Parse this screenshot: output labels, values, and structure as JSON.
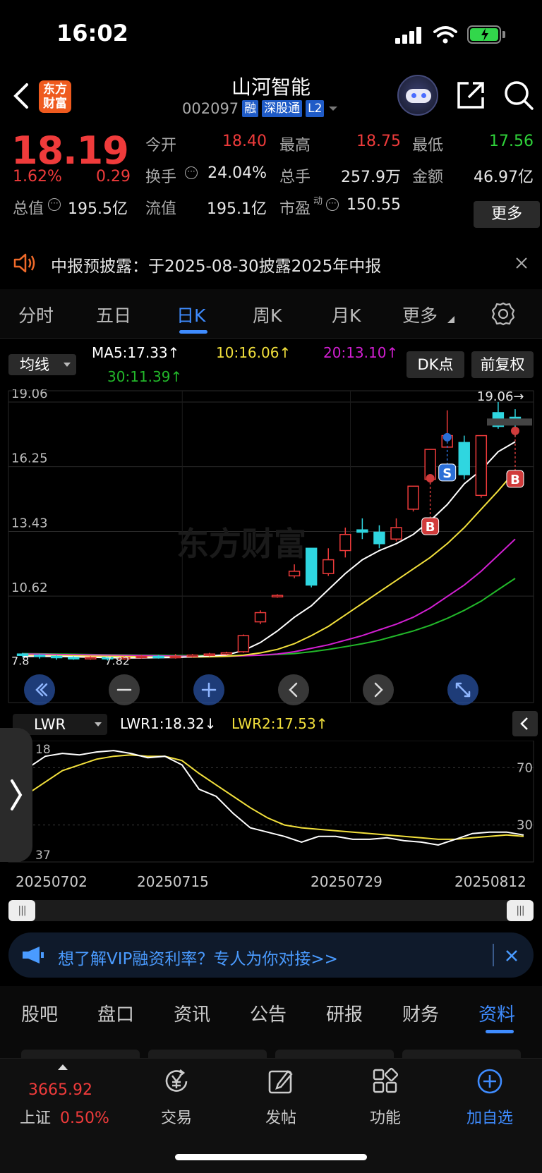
{
  "status_bar": {
    "time": "16:02"
  },
  "header": {
    "title": "山河智能",
    "code": "002097",
    "tags": [
      "融",
      "深股通",
      "L2"
    ],
    "logo_line1": "东方",
    "logo_line2": "财富"
  },
  "quote": {
    "price": "18.19",
    "change_pct": "1.62%",
    "change": "0.29",
    "total_value_label": "总值",
    "total_value": "195.5亿",
    "open_label": "今开",
    "open": "18.40",
    "high_label": "最高",
    "high": "18.75",
    "low_label": "最低",
    "low": "17.56",
    "turnover_label": "换手",
    "turnover": "24.04%",
    "volume_label": "总手",
    "volume": "257.9万",
    "amount_label": "金额",
    "amount": "46.97亿",
    "float_label": "流值",
    "float": "195.1亿",
    "pe_label": "市盈",
    "pe_sup": "动",
    "pe": "150.55",
    "more_label": "更多"
  },
  "notice": {
    "text": "中报预披露：于2025-08-30披露2025年中报"
  },
  "period_tabs": [
    {
      "label": "分时"
    },
    {
      "label": "五日"
    },
    {
      "label": "日K",
      "active": true
    },
    {
      "label": "周K"
    },
    {
      "label": "月K"
    },
    {
      "label": "更多"
    }
  ],
  "ma_row": {
    "selector": "均线",
    "ma5": "MA5:17.33↑",
    "ma10": "10:16.06↑",
    "ma20": "20:13.10↑",
    "ma30": "30:11.39↑",
    "dk_label": "DK点",
    "adjust_label": "前复权"
  },
  "colors": {
    "up": "#ef3b3b",
    "down": "#2fd6e0",
    "ma5": "#ffffff",
    "ma10": "#f2e03c",
    "ma20": "#d21fd2",
    "ma30": "#22b82a",
    "accent": "#3f8cff"
  },
  "chart_data": {
    "type": "candlestick",
    "y_ticks": [
      "19.06",
      "16.25",
      "13.43",
      "10.62"
    ],
    "ylim": [
      7.8,
      19.06
    ],
    "high_marker": "19.06→",
    "low_marker": "7.82",
    "left_low_label": "7.8",
    "watermark": "东方财富",
    "candles": [
      {
        "o": 8.1,
        "c": 8.05,
        "h": 8.15,
        "l": 7.95
      },
      {
        "o": 8.05,
        "c": 8.0,
        "h": 8.1,
        "l": 7.9
      },
      {
        "o": 8.0,
        "c": 7.95,
        "h": 8.05,
        "l": 7.85
      },
      {
        "o": 7.95,
        "c": 7.9,
        "h": 8.0,
        "l": 7.85
      },
      {
        "o": 7.9,
        "c": 7.95,
        "h": 8.0,
        "l": 7.85
      },
      {
        "o": 7.95,
        "c": 7.9,
        "h": 8.0,
        "l": 7.82
      },
      {
        "o": 7.9,
        "c": 7.95,
        "h": 8.0,
        "l": 7.85
      },
      {
        "o": 7.95,
        "c": 8.0,
        "h": 8.05,
        "l": 7.9
      },
      {
        "o": 8.0,
        "c": 7.95,
        "h": 8.05,
        "l": 7.9
      },
      {
        "o": 7.95,
        "c": 8.0,
        "h": 8.1,
        "l": 7.9
      },
      {
        "o": 8.0,
        "c": 8.05,
        "h": 8.1,
        "l": 7.95
      },
      {
        "o": 8.05,
        "c": 8.1,
        "h": 8.15,
        "l": 8.0
      },
      {
        "o": 8.1,
        "c": 8.15,
        "h": 8.2,
        "l": 8.05
      },
      {
        "o": 8.2,
        "c": 8.9,
        "h": 8.95,
        "l": 8.15
      },
      {
        "o": 9.5,
        "c": 9.9,
        "h": 10.0,
        "l": 9.4
      },
      {
        "o": 10.6,
        "c": 10.65,
        "h": 10.7,
        "l": 10.55
      },
      {
        "o": 11.5,
        "c": 11.7,
        "h": 12.0,
        "l": 11.4
      },
      {
        "o": 12.7,
        "c": 11.1,
        "h": 12.7,
        "l": 11.0
      },
      {
        "o": 11.6,
        "c": 12.2,
        "h": 12.7,
        "l": 11.5
      },
      {
        "o": 12.6,
        "c": 13.3,
        "h": 13.6,
        "l": 12.3
      },
      {
        "o": 13.5,
        "c": 13.4,
        "h": 14.0,
        "l": 13.1
      },
      {
        "o": 13.4,
        "c": 12.9,
        "h": 13.7,
        "l": 12.7
      },
      {
        "o": 13.1,
        "c": 13.6,
        "h": 14.0,
        "l": 13.0
      },
      {
        "o": 14.4,
        "c": 15.4,
        "h": 15.4,
        "l": 14.3
      },
      {
        "o": 15.7,
        "c": 17.0,
        "h": 17.0,
        "l": 15.5
      },
      {
        "o": 17.1,
        "c": 17.6,
        "h": 18.7,
        "l": 17.1
      },
      {
        "o": 17.3,
        "c": 15.9,
        "h": 17.6,
        "l": 15.7
      },
      {
        "o": 15.0,
        "c": 17.6,
        "h": 17.6,
        "l": 14.9
      },
      {
        "o": 18.6,
        "c": 18.0,
        "h": 19.06,
        "l": 17.9
      },
      {
        "o": 18.4,
        "c": 18.19,
        "h": 18.75,
        "l": 17.56
      }
    ],
    "ma5": [
      8.0,
      8.0,
      8.0,
      7.98,
      7.96,
      7.94,
      7.93,
      7.93,
      7.94,
      7.95,
      7.98,
      8.02,
      8.06,
      8.25,
      8.6,
      9.1,
      9.7,
      10.2,
      10.9,
      11.6,
      12.2,
      12.6,
      12.9,
      13.3,
      13.9,
      14.6,
      15.5,
      16.1,
      16.9,
      17.33
    ],
    "ma10": [
      8.05,
      8.04,
      8.03,
      8.02,
      8.01,
      8.0,
      7.99,
      7.98,
      7.97,
      7.97,
      7.97,
      7.98,
      8.0,
      8.05,
      8.15,
      8.3,
      8.55,
      8.9,
      9.3,
      9.8,
      10.3,
      10.8,
      11.3,
      11.8,
      12.3,
      12.9,
      13.6,
      14.4,
      15.2,
      16.06
    ],
    "ma20": [
      8.1,
      8.09,
      8.08,
      8.07,
      8.06,
      8.05,
      8.04,
      8.03,
      8.02,
      8.01,
      8.0,
      8.0,
      8.0,
      8.02,
      8.05,
      8.1,
      8.2,
      8.35,
      8.5,
      8.7,
      8.9,
      9.15,
      9.4,
      9.7,
      10.1,
      10.6,
      11.1,
      11.7,
      12.4,
      13.1
    ],
    "ma30": [
      8.12,
      8.11,
      8.1,
      8.09,
      8.08,
      8.07,
      8.06,
      8.05,
      8.05,
      8.04,
      8.04,
      8.03,
      8.03,
      8.04,
      8.05,
      8.08,
      8.12,
      8.2,
      8.3,
      8.42,
      8.55,
      8.7,
      8.9,
      9.1,
      9.35,
      9.65,
      10.0,
      10.4,
      10.9,
      11.39
    ],
    "signals": [
      {
        "label": "B",
        "index": 24
      },
      {
        "label": "S",
        "index": 25
      },
      {
        "label": "B",
        "index": 29
      }
    ]
  },
  "lwr": {
    "selector": "LWR",
    "lwr1": "LWR1:18.32↓",
    "lwr2": "LWR2:17.53↑",
    "left_top": "18",
    "left_bottom": "37",
    "right_top": "70",
    "right_mid": "30",
    "lwr1_values": [
      70,
      78,
      80,
      79,
      81,
      82,
      80,
      77,
      78,
      72,
      55,
      50,
      38,
      28,
      25,
      22,
      18,
      22,
      22,
      20,
      20,
      21,
      19,
      18,
      16,
      20,
      24,
      25,
      25,
      23
    ],
    "lwr2_values": [
      52,
      60,
      68,
      72,
      76,
      78,
      79,
      78,
      78,
      75,
      66,
      58,
      50,
      42,
      35,
      30,
      28,
      27,
      26,
      25,
      24,
      23,
      22,
      21,
      20,
      20,
      21,
      22,
      23,
      22
    ]
  },
  "dates": [
    "20250702",
    "20250715",
    "20250729",
    "20250812"
  ],
  "vip": {
    "text": "想了解VIP融资利率？专人为你对接>>"
  },
  "info_tabs": [
    {
      "label": "股吧"
    },
    {
      "label": "盘口"
    },
    {
      "label": "资讯"
    },
    {
      "label": "公告"
    },
    {
      "label": "研报"
    },
    {
      "label": "财务"
    },
    {
      "label": "资料",
      "active": true
    }
  ],
  "dock": {
    "index_value": "3665.92",
    "index_name": "上证",
    "index_change": "0.50%",
    "trade": "交易",
    "post": "发帖",
    "func": "功能",
    "watch": "加自选"
  }
}
